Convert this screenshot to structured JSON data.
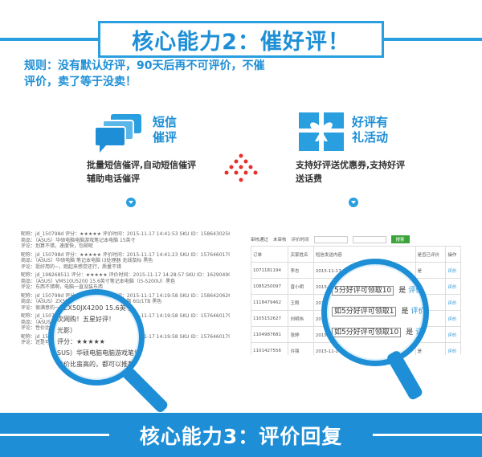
{
  "title2": "核心能力2：催好评！",
  "rule": "规则：没有默认好评，90天后再不可评价，不催评价，卖了等于没卖！",
  "feature_left": {
    "label_line1": "短信",
    "label_line2": "催评",
    "desc_line1": "批量短信催评,自动短信催评",
    "desc_line2": "辅助电话催评"
  },
  "feature_right": {
    "label_line1": "好评有",
    "label_line2": "礼活动",
    "desc_line1": "支持好评送优惠券,支持好评",
    "desc_line2": "送话费"
  },
  "left_shot": {
    "rows": [
      "昵称：jd_150798d    评分：★★★★★    评价时间：2015-11-17 14:41:53    SKU ID：1586430256",
      "商品：（ASUS）华硕电脑电脑游戏笔记本电脑 15英寸",
      "评论：划算不错，速度快，包邮呢",
      "昵称：jd_150798d    评分：★★★★★    评价时间：2015-11-17 14:41:23    SKU ID：1576460179",
      "商品：（ASUS）华硕电脑 笔记本电脑 i3处理器 无线鼠标 黑色",
      "评论：挺好用的~，跑起来感觉还行，质量不错",
      "昵称：jd_198268511    评分：★★★★★    评价时间：2015-11-17 14:28:57    SKU ID：1629049004",
      "商品：（ASUS）VM510U5200 15.6英寸笔记本电脑（i5-5200U）黑色",
      "评论：东西不错啊，电脑一直没装东西",
      "昵称：jd_150798d    评分：★★★★★    评价时间：2015-11-17 14:19:58    SKU ID：1586420626",
      "商品：（ASUS）ZX50JX4200 15.6英寸笔记本电脑 6G/1TB 黑色",
      "评论：很满意的一次网购！五星好评！",
      "昵称：jd_150798d    评分：★★★★★    评价时间：2015-11-17 14:19:58    SKU ID：1576460179",
      "商品：（ASUS）华硕电脑 笔记本电脑 i3 黑色",
      "评论：性价比蛮高的，都可以推荐",
      "昵称：jd_150798d    评分：★★★★★    评价时间：2015-11-17 14:19:58    SKU ID：1576460179",
      "评论：还是可以的吧"
    ],
    "lens_lines": [
      "）ZX50JX4200 15.6英寸笔记",
      "次网购！五星好评！",
      "光影）",
      "评分：★★★★★",
      "SUS）华硕电脑电脑游戏笔记本",
      "性价比蛮高的，都可以推荐"
    ]
  },
  "right_shot": {
    "toolbar": [
      "审核通过",
      "未审核",
      "评价时间",
      "搜索"
    ],
    "headers": [
      "订单",
      "买家姓名",
      "短信发送内容",
      "是否已评价",
      "操作"
    ],
    "rows": [
      [
        "1071181194",
        "李志",
        "2015-11-17 09:17:41 亲爱的顾客您好…",
        "是",
        "评价"
      ],
      [
        "1085250097",
        "曾小明",
        "2015-11-17 09:16:41 亲爱的顾客您好…",
        "是",
        "评价"
      ],
      [
        "1118479462",
        "王刚",
        "2015-11-17 08:21:12 亲爱的顾客您好…",
        "是",
        "评价"
      ],
      [
        "1105152627",
        "刘明伟",
        "2015-11-17 07:52:44 亲爱的顾客您好…",
        "是",
        "评价"
      ],
      [
        "1104987681",
        "张婷",
        "2015-11-17 06:54:31 亲爱的顾客您好…",
        "是",
        "评价"
      ],
      [
        "1101427556",
        "许强",
        "2015-11-17 05:51:30 亲爱的顾客您好…",
        "是",
        "评价"
      ]
    ],
    "lens_lines": [
      "5分好评可领取10",
      "如5分好评可领取1",
      "如5分好评可领取10"
    ],
    "lens_yes": "是",
    "lens_action": "评价"
  },
  "title3": "核心能力3：评价回复"
}
